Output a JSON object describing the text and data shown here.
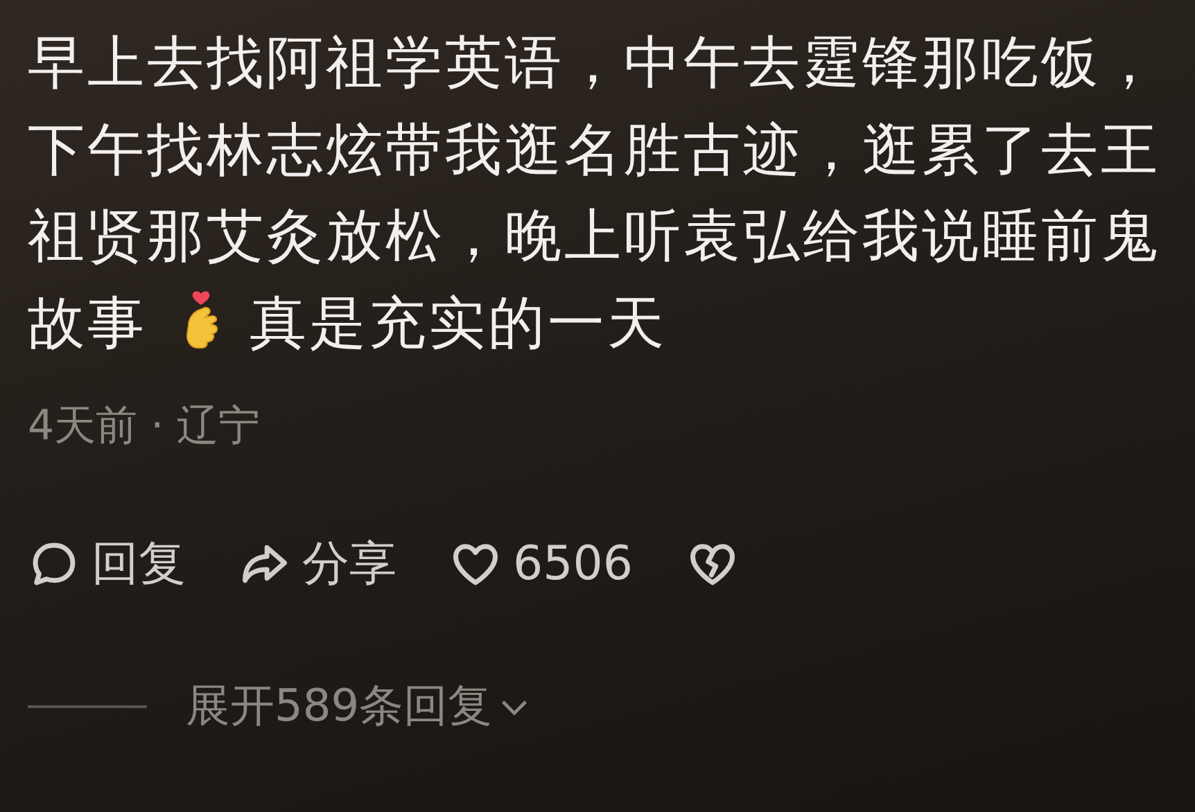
{
  "comment": {
    "text": "早上去找阿祖学英语，中午去霆锋那吃饭，下午找林志炫带我逛名胜古迹，逛累了去王祖贤那艾灸放松，晚上听袁弘给我说睡前鬼",
    "text_end": "故事",
    "text_after": "真是充实的一天",
    "meta": "4天前 · 辽宁"
  },
  "actions": [
    {
      "kind": "reply",
      "label": "回复"
    },
    {
      "kind": "share",
      "label": "分享"
    },
    {
      "kind": "like",
      "label": "6506"
    },
    {
      "kind": "dislike"
    }
  ],
  "expand": {
    "label": "展开589条回复"
  }
}
